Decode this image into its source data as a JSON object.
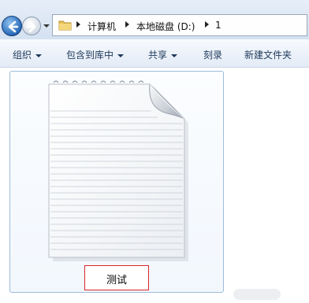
{
  "navigation": {
    "back_icon": "back-arrow-icon",
    "forward_icon": "forward-arrow-icon",
    "history_icon": "chevron-down-icon"
  },
  "address_bar": {
    "folder_icon": "folder-icon",
    "crumbs": [
      "计算机",
      "本地磁盘 (D:)",
      "1"
    ]
  },
  "toolbar": {
    "organize": "组织",
    "include_in_library": "包含到库中",
    "share": "共享",
    "burn": "刻录",
    "new_folder": "新建文件夹"
  },
  "file": {
    "icon": "text-document-icon",
    "name": "测试",
    "highlight_color": "#d8262a"
  }
}
